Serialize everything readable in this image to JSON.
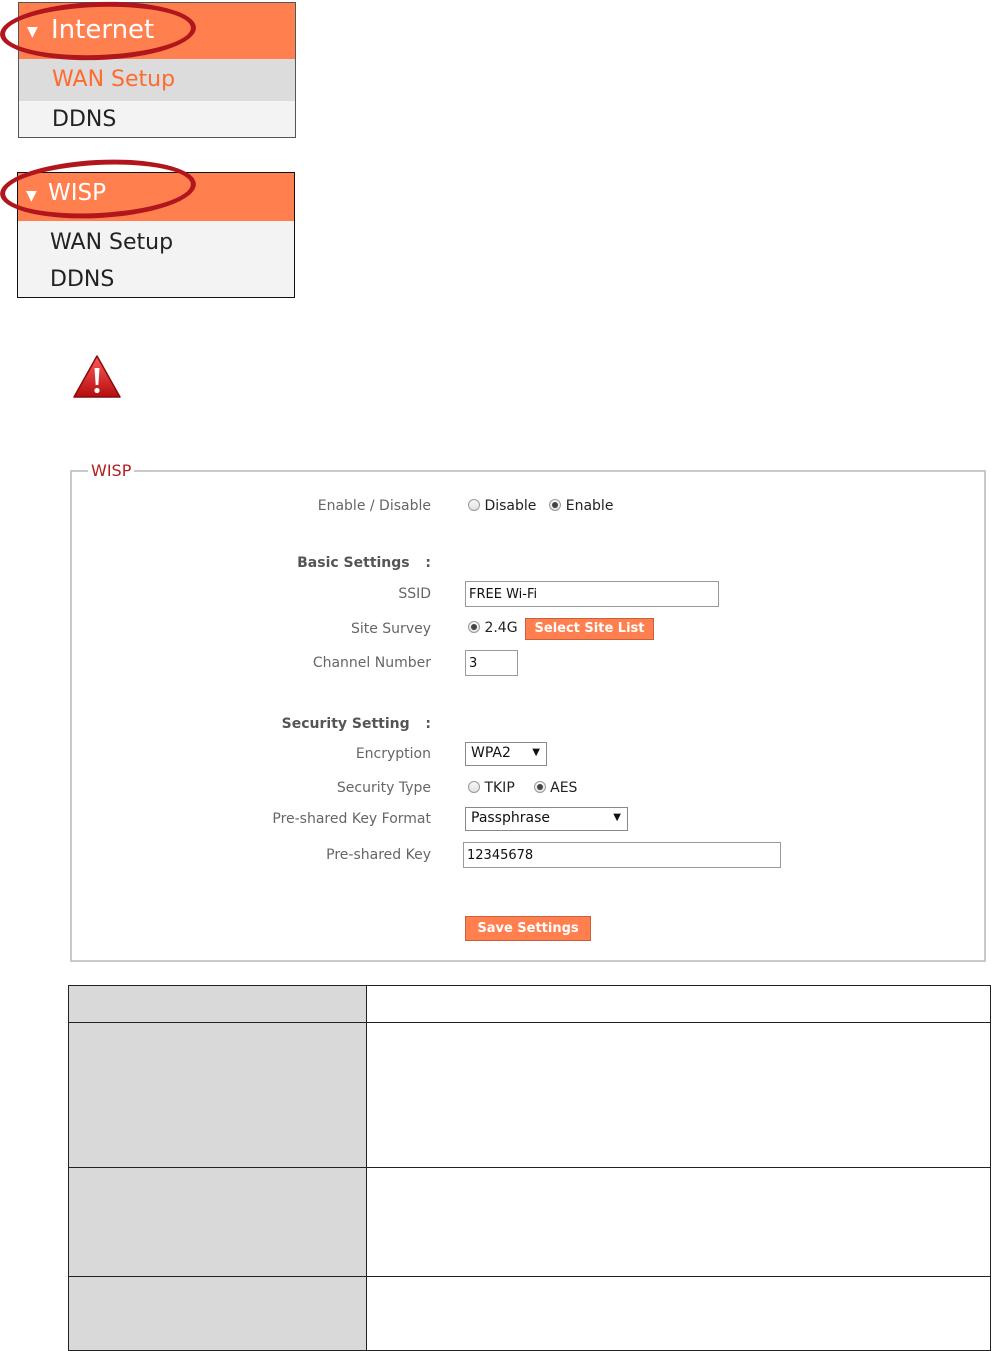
{
  "menu_internet": {
    "header": "Internet",
    "items": [
      "WAN Setup",
      "DDNS"
    ]
  },
  "menu_wisp": {
    "header": "WISP",
    "items": [
      "WAN Setup",
      "DDNS"
    ]
  },
  "wisp_form": {
    "legend": "WISP",
    "enable_disable": {
      "label": "Enable / Disable",
      "options": [
        "Disable",
        "Enable"
      ],
      "selected": "Enable"
    },
    "basic_settings": {
      "heading": "Basic Settings",
      "colon": ":",
      "ssid": {
        "label": "SSID",
        "value": "FREE Wi-Fi"
      },
      "site_survey": {
        "label": "Site Survey",
        "band": "2.4G",
        "button": "Select Site List"
      },
      "channel_number": {
        "label": "Channel Number",
        "value": "3"
      }
    },
    "security_setting": {
      "heading": "Security Setting",
      "colon": ":",
      "encryption": {
        "label": "Encryption",
        "value": "WPA2"
      },
      "security_type": {
        "label": "Security Type",
        "options": [
          "TKIP",
          "AES"
        ],
        "selected": "AES"
      },
      "key_format": {
        "label": "Pre-shared Key Format",
        "value": "Passphrase"
      },
      "psk": {
        "label": "Pre-shared Key",
        "value": "12345678"
      }
    },
    "save_button": "Save Settings"
  },
  "colors": {
    "accent_orange": "#ff7f4f",
    "highlight_ring": "#b0161c",
    "legend_red": "#b31e1e",
    "table_key_bg": "#d9d9d9"
  },
  "icons": {
    "warning": "warning-triangle-icon",
    "menu_arrow": "triangle-down-icon"
  }
}
